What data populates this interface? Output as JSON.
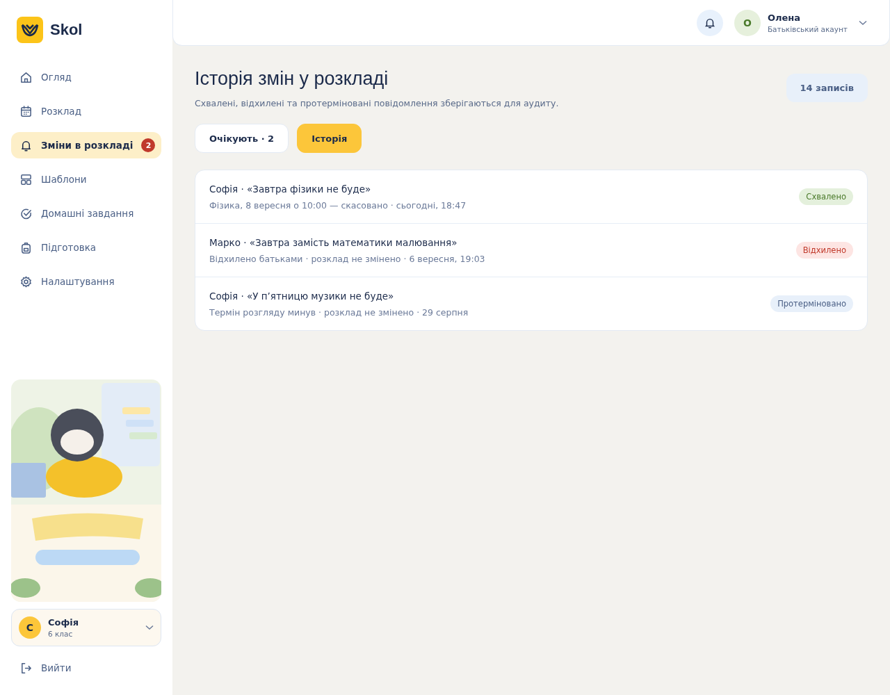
{
  "brand": {
    "name": "Skol"
  },
  "nav": [
    {
      "label": "Огляд",
      "selected": false
    },
    {
      "label": "Розклад",
      "selected": false
    },
    {
      "label": "Зміни в розкладі",
      "selected": true,
      "badge": "2"
    },
    {
      "label": "Шаблони",
      "selected": false
    },
    {
      "label": "Домашні завдання",
      "selected": false
    },
    {
      "label": "Підготовка",
      "selected": false
    },
    {
      "label": "Налаштування",
      "selected": false
    }
  ],
  "child": {
    "initial": "С",
    "name": "Софія",
    "grade": "6 клас"
  },
  "logout": "Вийти",
  "header": {
    "user": {
      "initial": "О",
      "name": "Олена",
      "role": "Батьківський акаунт"
    }
  },
  "page": {
    "title": "Історія змін у розкладі",
    "subtitle": "Схвалені, відхилені та протерміновані повідомлення зберігаються для аудиту.",
    "count": "14 записів"
  },
  "tabs": [
    {
      "label": "Очікують · 2",
      "selected": false
    },
    {
      "label": "Історія",
      "selected": true
    }
  ],
  "entries": [
    {
      "title": "Софія · «Завтра фізики не буде»",
      "details": "Фізика, 8 вересня о 10:00 — скасовано · сьогодні, 18:47",
      "status": "Схвалено",
      "kind": "approved"
    },
    {
      "title": "Марко · «Завтра замість математики малювання»",
      "details": "Відхилено батьками · розклад не змінено · 6 вересня, 19:03",
      "status": "Відхилено",
      "kind": "rejected"
    },
    {
      "title": "Софія · «У п’ятницю музики не буде»",
      "details": "Термін розгляду минув · розклад не змінено · 29 серпня",
      "status": "Протерміновано",
      "kind": "expired"
    }
  ]
}
